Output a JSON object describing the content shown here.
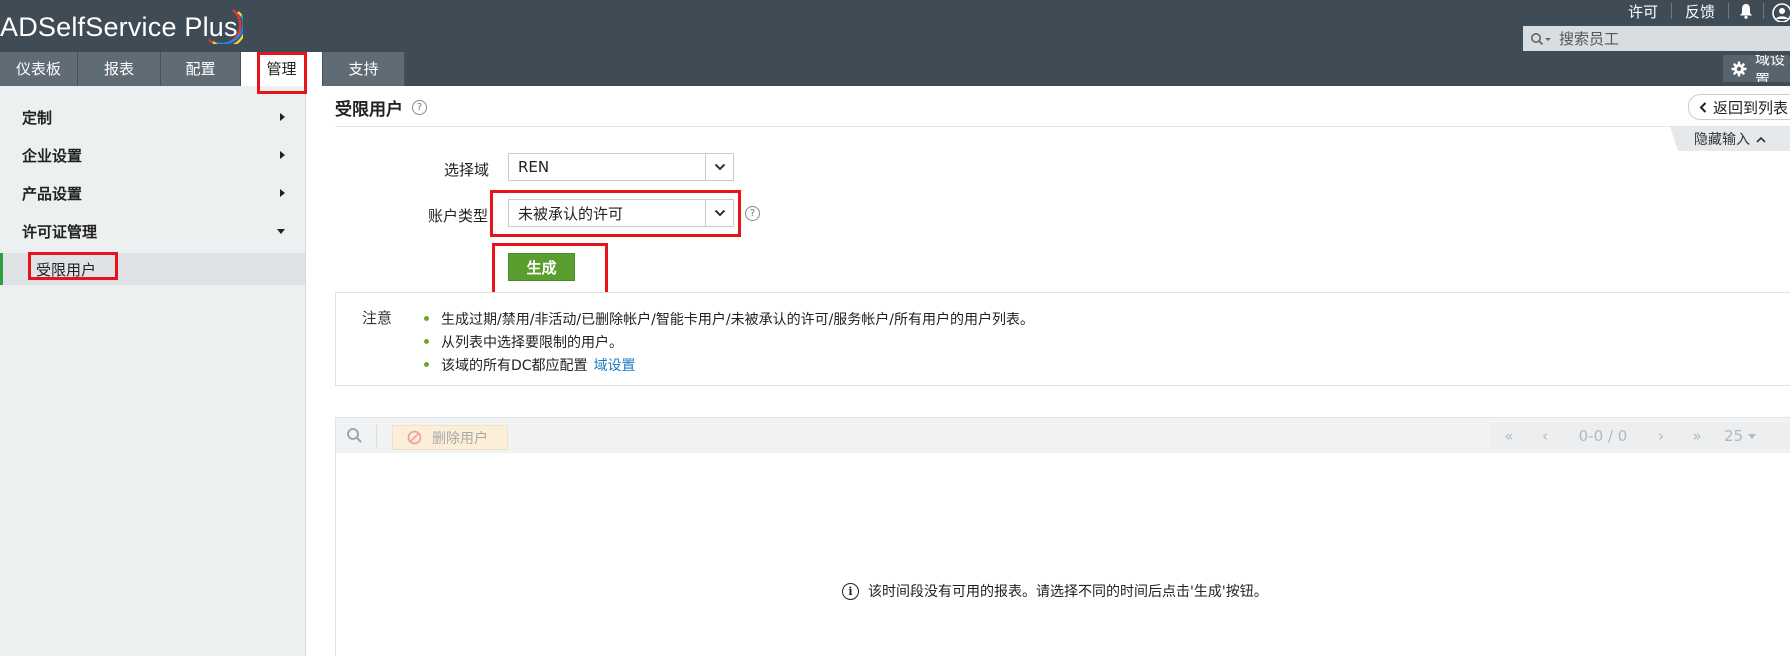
{
  "app": {
    "logo_text": "ADSelfService Plus",
    "top_links": [
      "许可",
      "反馈"
    ],
    "search_placeholder": "搜索员工",
    "nav_tabs": [
      {
        "label": "仪表板",
        "active": false
      },
      {
        "label": "报表",
        "active": false
      },
      {
        "label": "配置",
        "active": false
      },
      {
        "label": "管理",
        "active": true
      },
      {
        "label": "支持",
        "active": false
      }
    ],
    "domain_settings_label": "域设置"
  },
  "sidebar": {
    "items": [
      {
        "label": "定制",
        "expanded": false
      },
      {
        "label": "企业设置",
        "expanded": false
      },
      {
        "label": "产品设置",
        "expanded": false
      },
      {
        "label": "许可证管理",
        "expanded": true
      }
    ],
    "sub_item": "受限用户"
  },
  "main": {
    "title": "受限用户",
    "help_glyph": "?",
    "back_label": "返回到列表",
    "hide_input_label": "隐藏输入",
    "form": {
      "domain_label": "选择域",
      "domain_value": "REN",
      "account_type_label": "账户类型",
      "account_type_value": "未被承认的许可",
      "generate_label": "生成"
    },
    "notes": {
      "label": "注意",
      "items": [
        "生成过期/禁用/非活动/已删除帐户/智能卡用户/未被承认的许可/服务帐户/所有用户的用户列表。",
        "从列表中选择要限制的用户。",
        "该域的所有DC都应配置"
      ],
      "link_label": "域设置"
    },
    "toolbar": {
      "delete_label": "删除用户",
      "pager_info": "0-0 / 0",
      "page_size": "25"
    },
    "empty_message": "该时间段没有可用的报表。请选择不同的时间后点击'生成'按钮。"
  },
  "colors": {
    "header_bg": "#3f4b55",
    "tab_bg": "#5f6b75",
    "generate_green": "#5a9e2f",
    "highlight_red": "#e8141c",
    "link_blue": "#1a7fc1",
    "bullet_green": "#6aa832"
  }
}
